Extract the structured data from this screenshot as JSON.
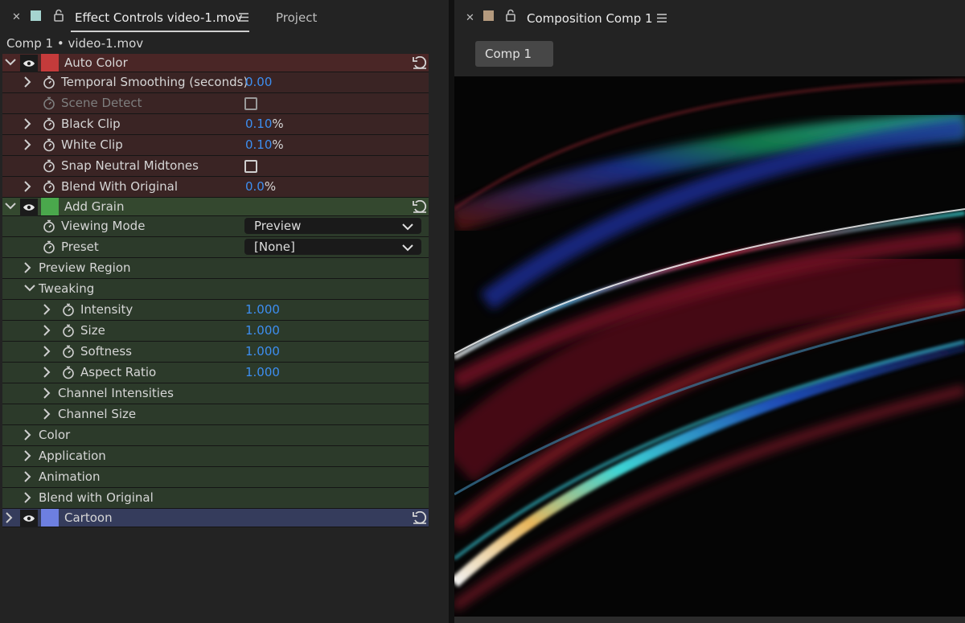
{
  "left_panel": {
    "tab_active": "Effect Controls video-1.mov",
    "tab_inactive": "Project",
    "active_swatch_color": "#a5d4d0",
    "subtitle": "Comp 1 • video-1.mov"
  },
  "effects": {
    "auto_color": {
      "name": "Auto Color",
      "color": "#c43b3b",
      "temporal_smoothing": {
        "label": "Temporal Smoothing (seconds)",
        "value": "0.00"
      },
      "scene_detect": {
        "label": "Scene Detect"
      },
      "black_clip": {
        "label": "Black Clip",
        "value": "0.10",
        "unit": "%"
      },
      "white_clip": {
        "label": "White Clip",
        "value": "0.10",
        "unit": "%"
      },
      "snap_neutral": {
        "label": "Snap Neutral Midtones"
      },
      "blend": {
        "label": "Blend With Original",
        "value": "0.0",
        "unit": "%"
      }
    },
    "add_grain": {
      "name": "Add Grain",
      "color": "#4aa84c",
      "viewing_mode": {
        "label": "Viewing Mode",
        "value": "Preview"
      },
      "preset": {
        "label": "Preset",
        "value": "[None]"
      },
      "preview_region": "Preview Region",
      "tweaking": {
        "label": "Tweaking",
        "intensity": {
          "label": "Intensity",
          "value": "1.000"
        },
        "size": {
          "label": "Size",
          "value": "1.000"
        },
        "softness": {
          "label": "Softness",
          "value": "1.000"
        },
        "aspect_ratio": {
          "label": "Aspect Ratio",
          "value": "1.000"
        },
        "channel_intensities": "Channel Intensities",
        "channel_size": "Channel Size"
      },
      "color_group": "Color",
      "application": "Application",
      "animation": "Animation",
      "blend_with_original": "Blend with Original"
    },
    "cartoon": {
      "name": "Cartoon",
      "color": "#6d7fe0"
    }
  },
  "right_panel": {
    "tab_title": "Composition Comp 1",
    "swatch_color": "#b49a7e",
    "comp_tab": "Comp 1"
  }
}
